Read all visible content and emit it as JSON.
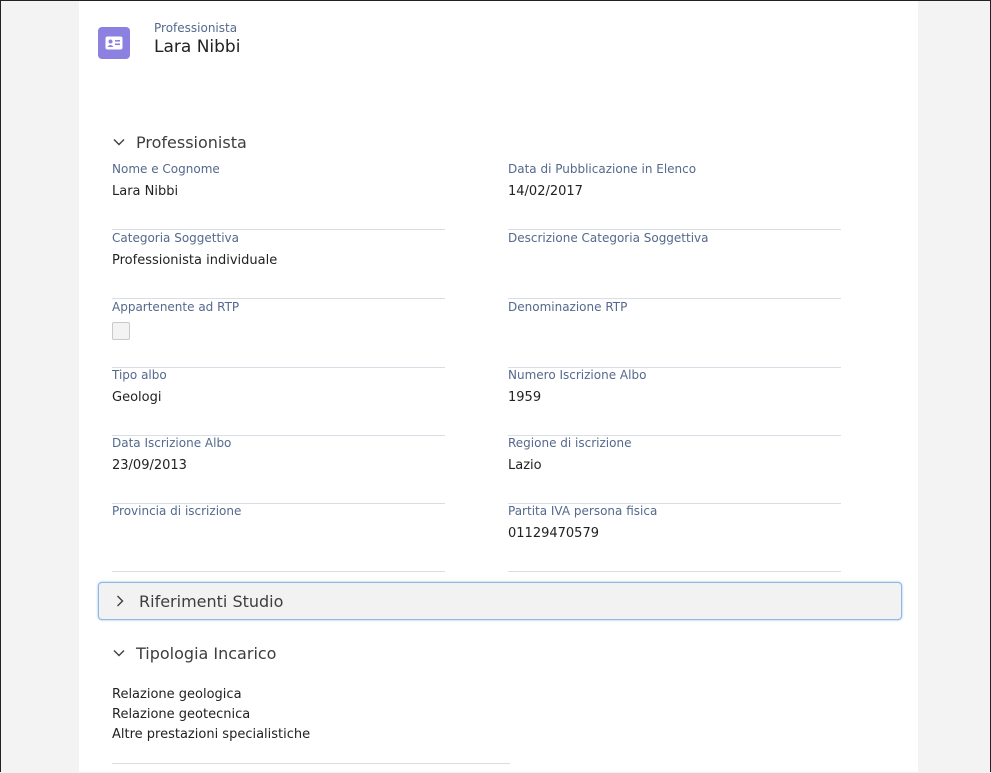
{
  "header": {
    "type_label": "Professionista",
    "name": "Lara Nibbi",
    "icon": "contact-card-icon",
    "icon_color": "#8c80e0"
  },
  "sections": {
    "professionista": {
      "title": "Professionista",
      "expanded": true,
      "fields": {
        "nome_cognome": {
          "label": "Nome e Cognome",
          "value": "Lara Nibbi"
        },
        "data_pubblicazione": {
          "label": "Data di Pubblicazione in Elenco",
          "value": "14/02/2017"
        },
        "categoria": {
          "label": "Categoria Soggettiva",
          "value": "Professionista individuale"
        },
        "descrizione_categoria": {
          "label": "Descrizione Categoria Soggettiva",
          "value": ""
        },
        "appartenente_rtp": {
          "label": "Appartenente ad RTP",
          "checked": false
        },
        "denominazione_rtp": {
          "label": "Denominazione RTP",
          "value": ""
        },
        "tipo_albo": {
          "label": "Tipo albo",
          "value": "Geologi"
        },
        "numero_albo": {
          "label": "Numero Iscrizione Albo",
          "value": "1959"
        },
        "data_albo": {
          "label": "Data Iscrizione Albo",
          "value": "23/09/2013"
        },
        "regione": {
          "label": "Regione di iscrizione",
          "value": "Lazio"
        },
        "provincia": {
          "label": "Provincia di iscrizione",
          "value": ""
        },
        "partita_iva": {
          "label": "Partita IVA persona fisica",
          "value": "01129470579"
        }
      }
    },
    "riferimenti_studio": {
      "title": "Riferimenti Studio",
      "expanded": false
    },
    "tipologia_incarico": {
      "title": "Tipologia Incarico",
      "expanded": true,
      "items": [
        "Relazione geologica",
        "Relazione geotecnica",
        "Altre prestazioni specialistiche"
      ]
    }
  },
  "colors": {
    "focus_border": "#8fb8e5",
    "label": "#54698d"
  }
}
